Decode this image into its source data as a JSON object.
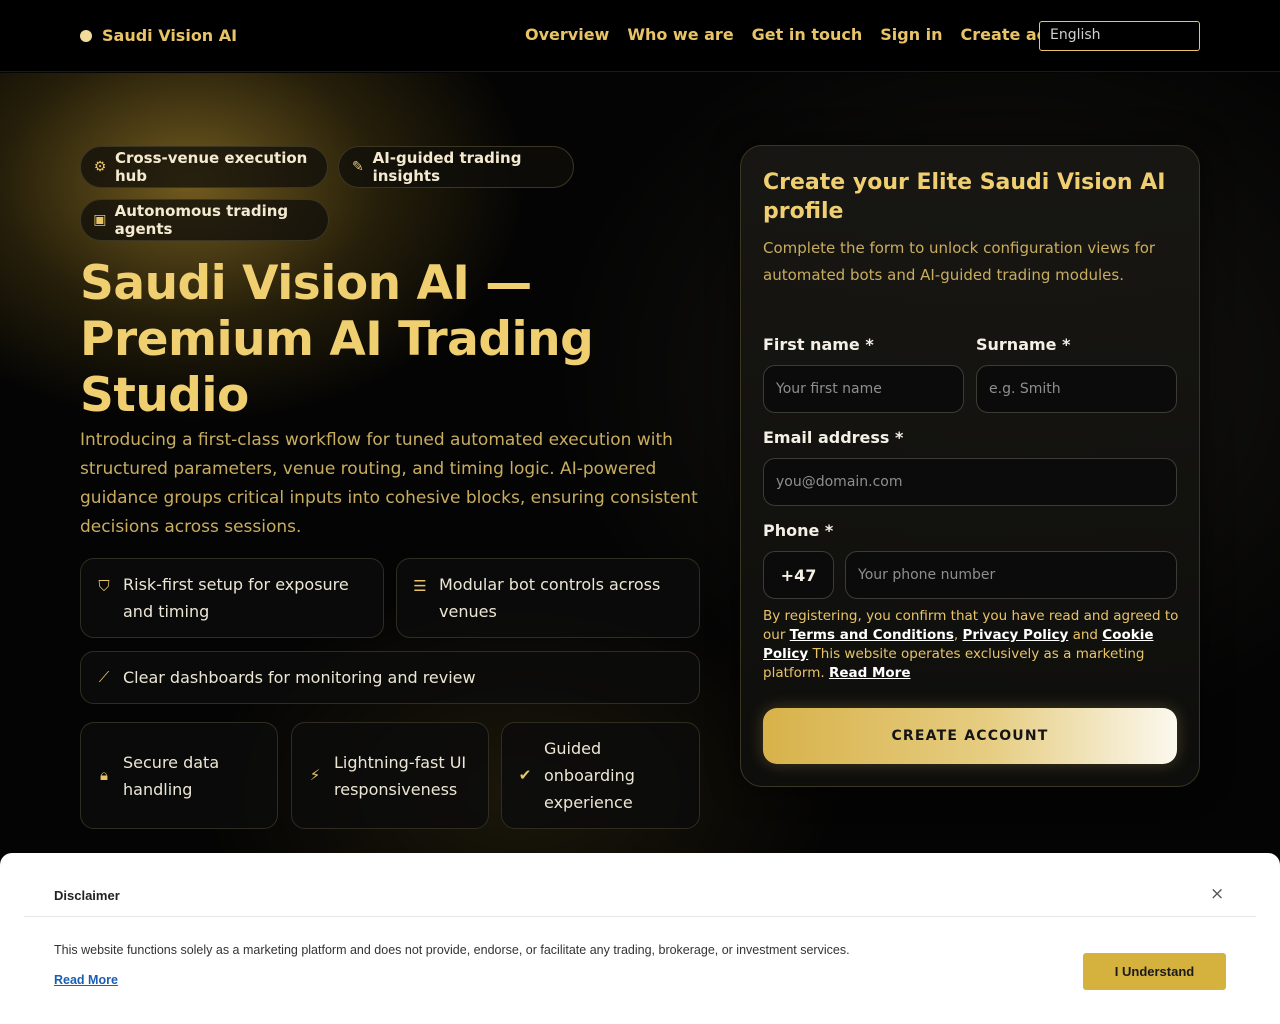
{
  "header": {
    "brand": "Saudi Vision AI",
    "nav": [
      "Overview",
      "Who we are",
      "Get in touch",
      "Sign in",
      "Create account"
    ],
    "language": "English"
  },
  "hero": {
    "chips": [
      {
        "icon": "hub-icon",
        "label": "Cross-venue execution hub"
      },
      {
        "icon": "magic-wand-icon",
        "label": "AI-guided trading insights"
      },
      {
        "icon": "robot-icon",
        "label": "Autonomous trading agents"
      }
    ],
    "title": "Saudi Vision AI — Premium AI Trading Studio",
    "intro": "Introducing a first-class workflow for tuned automated execution with structured parameters, venue routing, and timing logic. AI-powered guidance groups critical inputs into cohesive blocks, ensuring consistent decisions across sessions.",
    "features": [
      {
        "icon": "shield-icon",
        "label": "Risk-first setup for exposure and timing"
      },
      {
        "icon": "sliders-icon",
        "label": "Modular bot controls across venues"
      },
      {
        "icon": "chart-line-icon",
        "label": "Clear dashboards for monitoring and review"
      },
      {
        "icon": "lock-icon",
        "label": "Secure data handling"
      },
      {
        "icon": "bolt-icon",
        "label": "Lightning-fast UI responsiveness"
      },
      {
        "icon": "check-circle-icon",
        "label": "Guided onboarding experience"
      }
    ]
  },
  "form": {
    "title": "Create your Elite Saudi Vision AI profile",
    "subtitle": "Complete the form to unlock configuration views for automated bots and AI-guided trading modules.",
    "first_name_label": "First name *",
    "first_name_placeholder": "Your first name",
    "surname_label": "Surname *",
    "surname_placeholder": "e.g. Smith",
    "email_label": "Email address *",
    "email_placeholder": "you@domain.com",
    "phone_label": "Phone *",
    "phone_prefix": "+47",
    "phone_placeholder": "Your phone number",
    "legal_1": "By registering, you confirm that you have read and agreed to our ",
    "terms": "Terms and Conditions",
    "comma": ", ",
    "privacy": "Privacy Policy",
    "and": " and ",
    "cookie": "Cookie Policy",
    "legal_2": " This website operates exclusively as a marketing platform. ",
    "read_more": "Read More",
    "submit": "CREATE ACCOUNT"
  },
  "disclaimer": {
    "title": "Disclaimer",
    "close": "×",
    "text": "This website functions solely as a marketing platform and does not provide, endorse, or facilitate any trading, brokerage, or investment services.",
    "read_more": "Read More",
    "accept": "I Understand"
  },
  "colors": {
    "accent": "#e8c467",
    "background": "#050505",
    "button_gold": "#d4b23d"
  }
}
